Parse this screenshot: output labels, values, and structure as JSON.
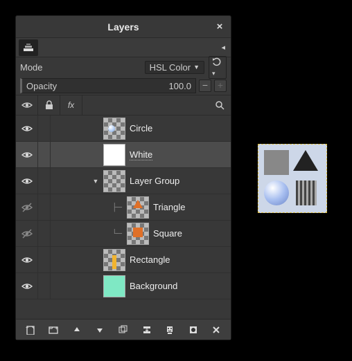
{
  "title": "Layers",
  "mode": {
    "label": "Mode",
    "value": "HSL Color"
  },
  "opacity": {
    "label": "Opacity",
    "value": "100.0"
  },
  "layers": [
    {
      "name": "Circle",
      "visible": true,
      "selected": false,
      "depth": 0,
      "thumb": "circle",
      "expand": ""
    },
    {
      "name": "White",
      "visible": true,
      "selected": true,
      "depth": 0,
      "thumb": "white",
      "expand": ""
    },
    {
      "name": "Layer Group",
      "visible": true,
      "selected": false,
      "depth": 0,
      "thumb": "checker",
      "expand": "down"
    },
    {
      "name": "Triangle",
      "visible": false,
      "selected": false,
      "depth": 1,
      "thumb": "triangle",
      "expand": ""
    },
    {
      "name": "Square",
      "visible": false,
      "selected": false,
      "depth": 1,
      "thumb": "square",
      "expand": "",
      "last": true
    },
    {
      "name": "Rectangle",
      "visible": true,
      "selected": false,
      "depth": 0,
      "thumb": "rect",
      "expand": ""
    },
    {
      "name": "Background",
      "visible": true,
      "selected": false,
      "depth": 0,
      "thumb": "mint",
      "expand": ""
    }
  ],
  "bottom_actions": [
    "new-layer",
    "new-group",
    "raise",
    "lower",
    "duplicate",
    "merge-down",
    "anchor",
    "mask",
    "delete"
  ]
}
